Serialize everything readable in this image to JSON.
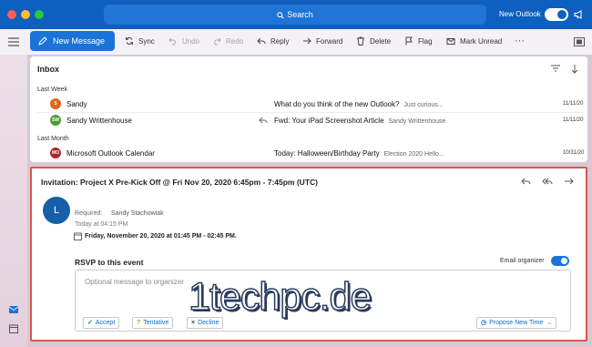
{
  "window": {
    "search_label": "Search",
    "new_outlook_label": "New Outlook"
  },
  "toolbar": {
    "new_message": "New Message",
    "sync": "Sync",
    "undo": "Undo",
    "redo": "Redo",
    "reply": "Reply",
    "forward": "Forward",
    "delete": "Delete",
    "flag": "Flag",
    "mark_unread": "Mark Unread",
    "more": "···"
  },
  "message_list": {
    "title": "Inbox",
    "groups": [
      {
        "label": "Last Week"
      },
      {
        "label": "Last Month"
      }
    ],
    "messages": [
      {
        "avatar": "S",
        "avatar_color": "#d9661f",
        "sender": "Sandy",
        "subject": "What do you think of the new Outlook?",
        "preview": "Just curious...",
        "date": "11/11/20"
      },
      {
        "avatar": "SW",
        "avatar_color": "#4a9e35",
        "sender": "Sandy Writtenhouse",
        "subject": "Fwd: Your iPad Screenshot Article",
        "preview": "Sandy Writtenhouse",
        "date": "11/11/20"
      },
      {
        "avatar": "MO",
        "avatar_color": "#a82a2a",
        "sender": "Microsoft Outlook Calendar",
        "subject": "Today: Halloween/Birthday Party",
        "preview": "Election 2020 Hello...",
        "date": "10/31/20"
      }
    ]
  },
  "reading_pane": {
    "title": "Invitation: Project X Pre-Kick Off @ Fri Nov 20, 2020 6:45pm - 7:45pm (UTC)",
    "sender_avatar": "L",
    "required_label": "Required:",
    "required_name": "Sandy Stachowiak",
    "sent_time": "Today at 04:15 PM",
    "event_datetime": "Friday, November 20, 2020 at 01:45 PM - 02:45 PM.",
    "rsvp_label": "RSVP to this event",
    "email_organizer_label": "Email organizer",
    "message_placeholder": "Optional message to organizer",
    "accept": "Accept",
    "tentative": "Tentative",
    "decline": "Decline",
    "propose_new_time": "Propose New Time"
  },
  "watermark": "1techpc.de"
}
